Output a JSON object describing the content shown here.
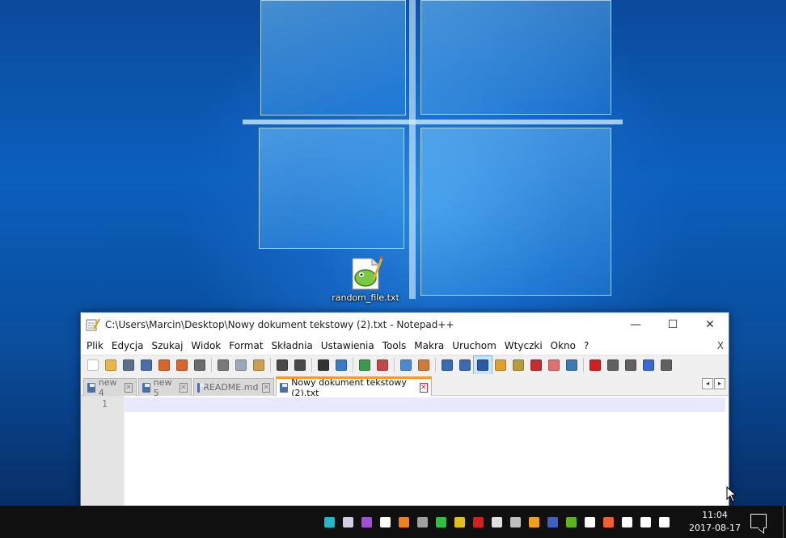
{
  "desktop": {
    "icon_label": "random_file.txt"
  },
  "window": {
    "title": "C:\\Users\\Marcin\\Desktop\\Nowy dokument tekstowy (2).txt - Notepad++",
    "buttons": {
      "minimize": "—",
      "maximize": "☐",
      "close": "✕"
    }
  },
  "menu": {
    "items": [
      "Plik",
      "Edycja",
      "Szukaj",
      "Widok",
      "Format",
      "Składnia",
      "Ustawienia",
      "Tools",
      "Makra",
      "Uruchom",
      "Wtyczki",
      "Okno",
      "?"
    ],
    "close_label": "X"
  },
  "toolbar": {
    "icons": [
      {
        "name": "new-file-icon",
        "color": "#ffffff"
      },
      {
        "name": "open-file-icon",
        "color": "#e8b64a"
      },
      {
        "name": "save-icon",
        "color": "#5c6f8c"
      },
      {
        "name": "save-all-icon",
        "color": "#4c6ea8"
      },
      {
        "name": "close-file-icon",
        "color": "#d9652b"
      },
      {
        "name": "close-all-icon",
        "color": "#d9652b"
      },
      {
        "name": "print-icon",
        "color": "#6c6c6c"
      },
      {
        "name": "sep"
      },
      {
        "name": "cut-icon",
        "color": "#7a7a7a"
      },
      {
        "name": "copy-icon",
        "color": "#9aa8bc"
      },
      {
        "name": "paste-icon",
        "color": "#c9a050"
      },
      {
        "name": "sep"
      },
      {
        "name": "undo-icon",
        "color": "#4a4a4a"
      },
      {
        "name": "redo-icon",
        "color": "#4a4a4a"
      },
      {
        "name": "sep"
      },
      {
        "name": "find-icon",
        "color": "#333333"
      },
      {
        "name": "replace-icon",
        "color": "#3a7bc8"
      },
      {
        "name": "sep"
      },
      {
        "name": "zoom-in-icon",
        "color": "#3c9a4c"
      },
      {
        "name": "zoom-out-icon",
        "color": "#c04a4a"
      },
      {
        "name": "sep"
      },
      {
        "name": "sync-vertical-icon",
        "color": "#4a8ad0"
      },
      {
        "name": "sync-horizontal-icon",
        "color": "#d07a3a"
      },
      {
        "name": "sep"
      },
      {
        "name": "word-wrap-icon",
        "color": "#3a6ab0"
      },
      {
        "name": "show-all-chars-icon",
        "color": "#3a6ab0"
      },
      {
        "name": "indent-guide-icon",
        "color": "#2a5aa0",
        "active": true
      },
      {
        "name": "doc-map-icon",
        "color": "#e0a030"
      },
      {
        "name": "function-list-icon",
        "color": "#b89a40"
      },
      {
        "name": "folder-workspace-icon",
        "color": "#c03030"
      },
      {
        "name": "doc-list-icon",
        "color": "#e07070"
      },
      {
        "name": "monitor-icon",
        "color": "#3a7ab0"
      },
      {
        "name": "sep"
      },
      {
        "name": "record-macro-icon",
        "color": "#d02020"
      },
      {
        "name": "stop-macro-icon",
        "color": "#606060"
      },
      {
        "name": "play-macro-icon",
        "color": "#606060"
      },
      {
        "name": "run-macro-multiple-icon",
        "color": "#3a6ad0"
      },
      {
        "name": "save-macro-icon",
        "color": "#606060"
      }
    ]
  },
  "tabs": [
    {
      "label": "new 4",
      "active": false
    },
    {
      "label": "new 5",
      "active": false
    },
    {
      "label": "README.md",
      "active": false
    },
    {
      "label": "Nowy dokument tekstowy (2).txt",
      "active": true
    }
  ],
  "tab_scroll": {
    "left": "◂",
    "right": "▸"
  },
  "editor": {
    "line_numbers": [
      "1"
    ],
    "content": ""
  },
  "taskbar": {
    "tray_icons": [
      {
        "name": "hex-app-icon",
        "color": "#1fb8c8"
      },
      {
        "name": "usb-device-icon",
        "color": "#d0d0e0"
      },
      {
        "name": "cube-app-icon",
        "color": "#a050d0"
      },
      {
        "name": "shield-defender-icon",
        "color": "#ffffff"
      },
      {
        "name": "sublime-icon",
        "color": "#f08020"
      },
      {
        "name": "network-plug-icon",
        "color": "#a0a0a0"
      },
      {
        "name": "link-app-icon",
        "color": "#30c040"
      },
      {
        "name": "chrome-icon",
        "color": "#e0c020"
      },
      {
        "name": "record-app-icon",
        "color": "#d02020"
      },
      {
        "name": "cursor-app-icon",
        "color": "#e0e0e0"
      },
      {
        "name": "half-moon-icon",
        "color": "#c0c0c0"
      },
      {
        "name": "media-app-icon",
        "color": "#f0a020"
      },
      {
        "name": "keepass-lock-icon",
        "color": "#4060c0"
      },
      {
        "name": "nvidia-icon",
        "color": "#60b020"
      },
      {
        "name": "bluetooth-icon",
        "color": "#ffffff"
      },
      {
        "name": "speaker-muted-app-icon",
        "color": "#f06030"
      },
      {
        "name": "battery-icon",
        "color": "#ffffff"
      },
      {
        "name": "wifi-icon",
        "color": "#ffffff"
      },
      {
        "name": "volume-icon",
        "color": "#ffffff"
      }
    ],
    "clock_time": "11:04",
    "clock_date": "2017-08-17"
  }
}
